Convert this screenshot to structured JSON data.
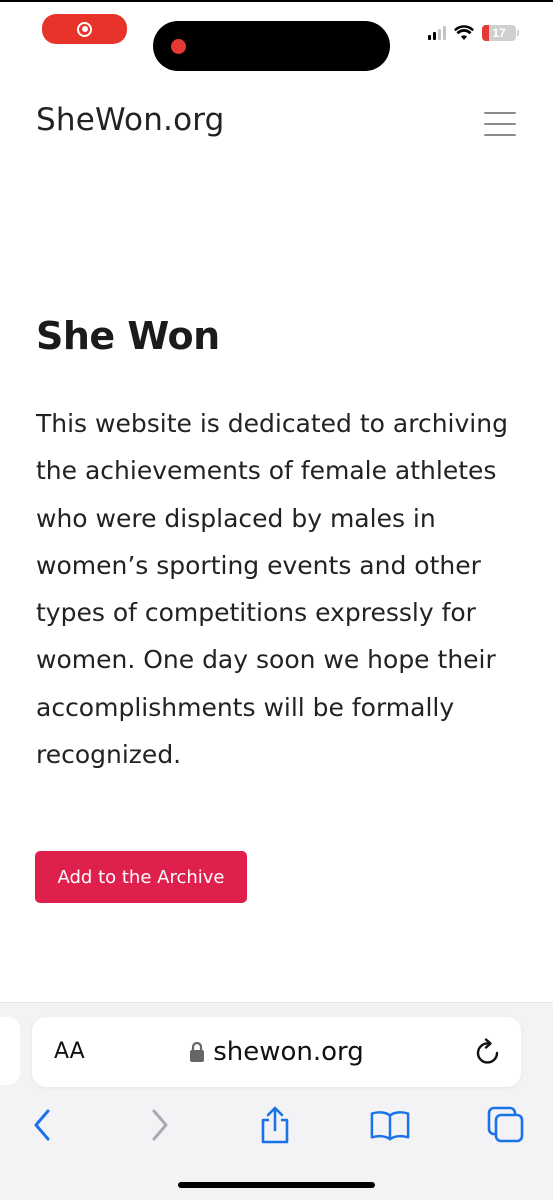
{
  "site": {
    "title": "SheWon.org"
  },
  "main": {
    "heading": "She Won",
    "intro": "This website is dedicated to archiving the achievements of female athletes who were displaced by males in women’s sporting events and other types of competitions expressly for women. One day soon we hope their accomplishments will be formally recognized.",
    "cta_label": "Add to the Archive"
  },
  "status_bar": {
    "battery_level": "17"
  },
  "browser": {
    "text_size_label": "AA",
    "url": "shewon.org"
  },
  "icons": {
    "recording": "screen-recording-icon",
    "signal": "cellular-signal-icon",
    "wifi": "wifi-icon",
    "battery": "battery-icon",
    "menu": "hamburger-menu-icon",
    "lock": "lock-icon",
    "reload": "reload-icon",
    "back": "chevron-left-icon",
    "forward": "chevron-right-icon",
    "share": "share-icon",
    "bookmarks": "book-icon",
    "tabs": "tabs-icon"
  },
  "colors": {
    "accent": "#e0204c",
    "recording": "#e8332b",
    "browser_blue": "#1a73e8"
  }
}
